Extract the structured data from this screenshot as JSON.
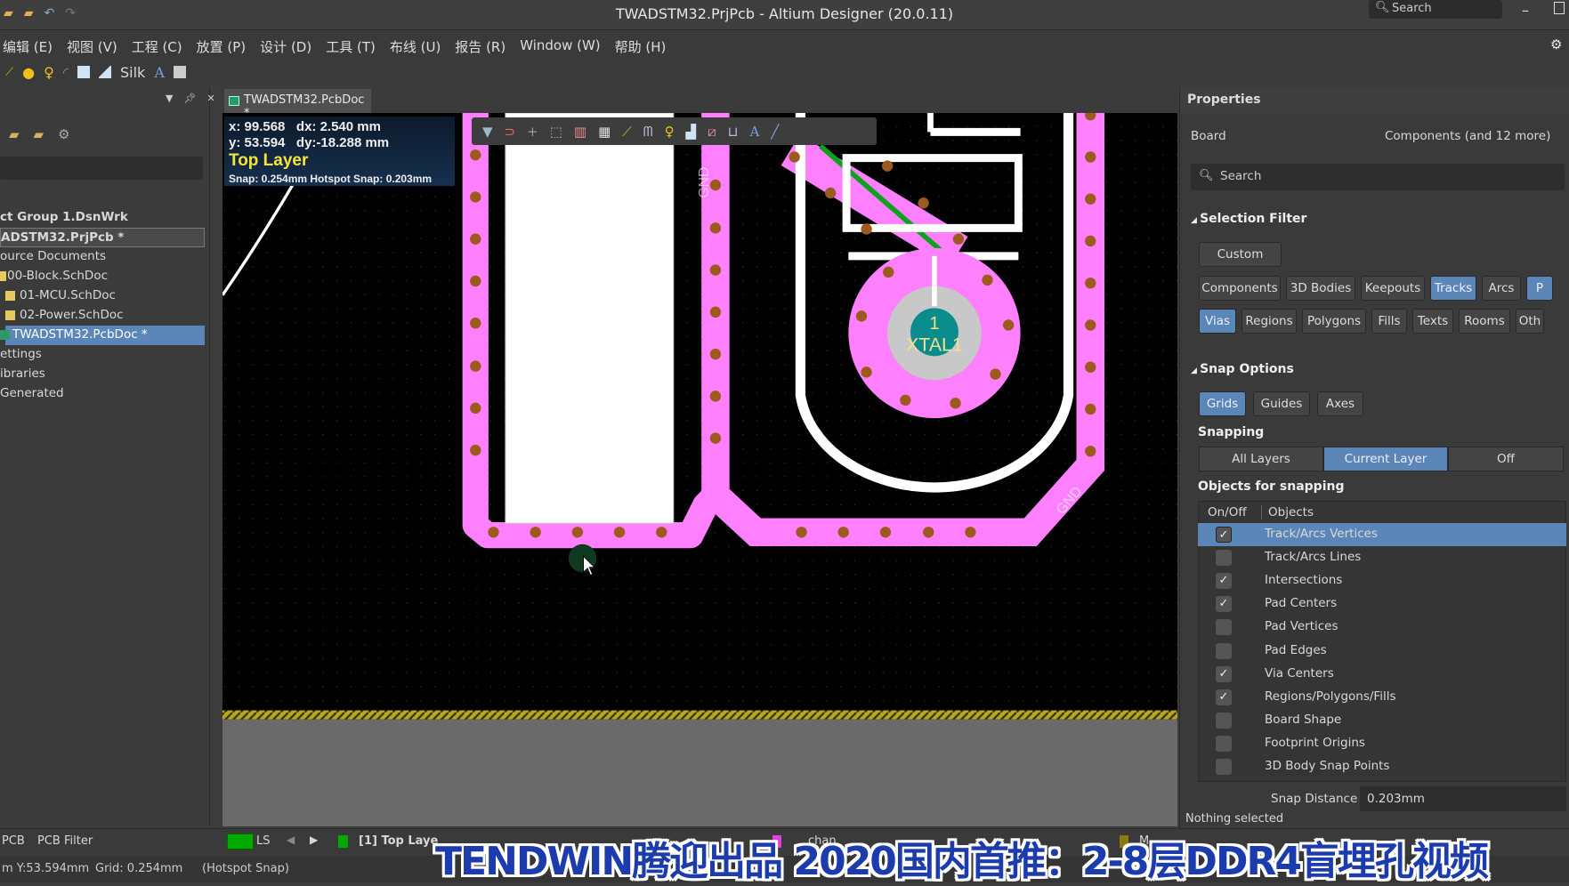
{
  "window": {
    "title": "TWADSTM32.PrjPcb - Altium Designer (20.0.11)",
    "search_placeholder": "Search"
  },
  "menu": [
    "编辑 (E)",
    "视图 (V)",
    "工程 (C)",
    "放置 (P)",
    "设计 (D)",
    "工具 (T)",
    "布线 (U)",
    "报告 (R)",
    "Window (W)",
    "帮助 (H)"
  ],
  "toolbar": {
    "silk_label": "Silk",
    "text_glyph": "A"
  },
  "project_panel": {
    "tree": [
      {
        "label": "ct Group 1.DsnWrk",
        "bold": true
      },
      {
        "label": "ADSTM32.PrjPcb *",
        "bold": true,
        "outlined": true
      },
      {
        "label": "ource Documents"
      },
      {
        "label": "00-Block.SchDoc",
        "icon": "schdoc"
      },
      {
        "label": "01-MCU.SchDoc",
        "icon": "schdoc"
      },
      {
        "label": "02-Power.SchDoc",
        "icon": "schdoc"
      },
      {
        "label": "TWADSTM32.PcbDoc *",
        "icon": "pcbdoc",
        "selected": true
      },
      {
        "label": "ettings"
      },
      {
        "label": "ibraries"
      },
      {
        "label": "Generated"
      }
    ]
  },
  "document_tab": {
    "label": "TWADSTM32.PcbDoc *"
  },
  "heads_up": {
    "x": "x: 99.568",
    "dx": "dx:  2.540  mm",
    "y": "y: 53.594",
    "dy": "dy:-18.288 mm",
    "layer": "Top Layer",
    "snap": "Snap: 0.254mm Hotspot Snap: 0.203mm"
  },
  "pcb": {
    "component_designator": "XTAL1",
    "pad_number": "1",
    "net_label": "GND",
    "colors": {
      "top_layer": "#ff80ff",
      "via": "#9c5a1e",
      "silk": "#ffffff",
      "track_green": "#10a020",
      "pad_hole": "#0a8c8c"
    }
  },
  "properties": {
    "title": "Properties",
    "board_label": "Board",
    "board_filter": "Components (and 12 more)",
    "search_placeholder": "Search",
    "selection_filter": {
      "title": "Selection Filter",
      "custom_label": "Custom",
      "row1": [
        {
          "label": "Components",
          "on": false
        },
        {
          "label": "3D Bodies",
          "on": false
        },
        {
          "label": "Keepouts",
          "on": false
        },
        {
          "label": "Tracks",
          "on": true
        },
        {
          "label": "Arcs",
          "on": false
        },
        {
          "label": "P",
          "on": true
        }
      ],
      "row2": [
        {
          "label": "Vias",
          "on": true
        },
        {
          "label": "Regions",
          "on": false
        },
        {
          "label": "Polygons",
          "on": false
        },
        {
          "label": "Fills",
          "on": false
        },
        {
          "label": "Texts",
          "on": false
        },
        {
          "label": "Rooms",
          "on": false
        },
        {
          "label": "Oth",
          "on": false
        }
      ]
    },
    "snap_options": {
      "title": "Snap Options",
      "modes": [
        {
          "label": "Grids",
          "on": true
        },
        {
          "label": "Guides",
          "on": false
        },
        {
          "label": "Axes",
          "on": false
        }
      ],
      "snapping_label": "Snapping",
      "snapping": [
        {
          "label": "All Layers",
          "on": false
        },
        {
          "label": "Current Layer",
          "on": true
        },
        {
          "label": "Off",
          "on": false
        }
      ],
      "objects_title": "Objects for snapping",
      "col_onoff": "On/Off",
      "col_objects": "Objects",
      "objects": [
        {
          "label": "Track/Arcs Vertices",
          "checked": true,
          "selected": true
        },
        {
          "label": "Track/Arcs Lines",
          "checked": false
        },
        {
          "label": "Intersections",
          "checked": true
        },
        {
          "label": "Pad Centers",
          "checked": true
        },
        {
          "label": "Pad Vertices",
          "checked": false
        },
        {
          "label": "Pad Edges",
          "checked": false
        },
        {
          "label": "Via Centers",
          "checked": true
        },
        {
          "label": "Regions/Polygons/Fills",
          "checked": true
        },
        {
          "label": "Board Shape",
          "checked": false
        },
        {
          "label": "Footprint Origins",
          "checked": false
        },
        {
          "label": "3D Body Snap Points",
          "checked": false
        }
      ],
      "snap_distance_label": "Snap Distance",
      "snap_distance_value": "0.203mm"
    },
    "status": "Nothing selected"
  },
  "statusbar": {
    "panel_tabs": [
      "PCB",
      "PCB Filter"
    ],
    "ls_label": "LS",
    "layer_tab": "[1] Top Laye",
    "partial_tabs": [
      "chan",
      "M"
    ],
    "coords": "m Y:53.594mm",
    "grid": "Grid: 0.254mm",
    "snap_mode": "(Hotspot Snap)"
  },
  "subtitle_overlay": "TENDWIN腾迎出品  2020国内首推：2-8层DDR4盲埋孔视频"
}
